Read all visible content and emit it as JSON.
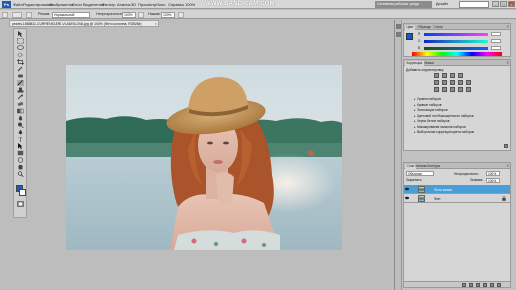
{
  "menubar": {
    "logo": "Ps",
    "items": [
      "Файл",
      "Редактирование",
      "Изображение",
      "Слои",
      "Выделение",
      "Фильтр",
      "Анализ",
      "3D",
      "Просмотр",
      "Окно",
      "Справка"
    ],
    "zoom": "100%",
    "watermark": "WWW.BANDICAM.COM",
    "workspace_essentials": "Основная рабочая среда",
    "workspace_design": "Дизайн"
  },
  "optionsbar": {
    "mode_label": "Режим:",
    "mode_value": "Нормальный",
    "opacity_label": "Непрозрачность:",
    "opacity_value": "100%",
    "flow_label": "Нажим:",
    "flow_value": "100%"
  },
  "document": {
    "tab_title": "pexels-1858811-CURRENSLERI-VLADISLOVA.jpg @ 100% (Фото колонна, RGB/8#)",
    "close": "×"
  },
  "colors": {
    "foreground": "#1a57c8",
    "background": "#ffffff",
    "sky": "#dfe8ec",
    "water": "#a9c2cc",
    "hat": "#c79a5c",
    "hair": "#b35b2b"
  },
  "panels": {
    "color": {
      "tabs": [
        "Цвет",
        "Образцы",
        "Стили"
      ],
      "channels": [
        "R",
        "G",
        "B"
      ]
    },
    "adjustments": {
      "tabs": [
        "Коррекция",
        "Маски"
      ],
      "title": "Добавить корректировку",
      "presets": [
        "Уровни наборов",
        "Кривые наборов",
        "Экспозиция наборов",
        "Цветовой тон/Насыщенность наборов",
        "Черно-белое наборов",
        "Микширование каналов наборов",
        "Выборочная коррекция цвета наборов"
      ]
    },
    "layers": {
      "tabs": [
        "Слои",
        "Каналы",
        "Контуры"
      ],
      "blend_mode": "Обычные",
      "opacity_label": "Непрозрачность:",
      "opacity_value": "100%",
      "lock_label": "Закрепить:",
      "fill_label": "Заливка:",
      "fill_value": "100%",
      "layers": [
        {
          "name": "Фото копия",
          "selected": true
        },
        {
          "name": "Фон",
          "selected": false
        }
      ]
    }
  }
}
